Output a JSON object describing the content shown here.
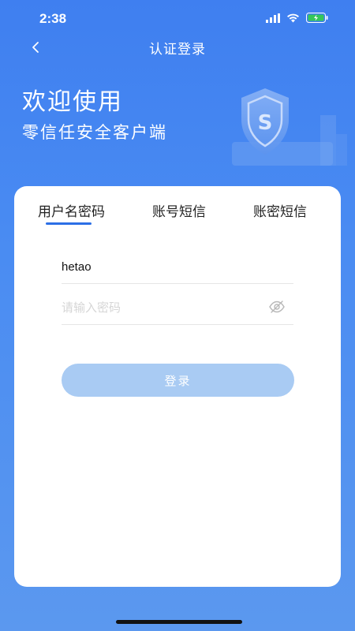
{
  "status_bar": {
    "time": "2:38"
  },
  "nav": {
    "back_icon": "chevron-left-icon",
    "title": "认证登录"
  },
  "hero": {
    "title": "欢迎使用",
    "subtitle": "零信任安全客户端",
    "shield_letter": "S"
  },
  "tabs": [
    {
      "label": "用户名密码",
      "active": true
    },
    {
      "label": "账号短信",
      "active": false
    },
    {
      "label": "账密短信",
      "active": false
    }
  ],
  "form": {
    "username_value": "hetao",
    "password_placeholder": "请输入密码",
    "password_toggle_icon": "eye-off-icon",
    "login_label": "登录"
  },
  "colors": {
    "background": "#4a8cf2",
    "active_tab_indicator": "#2c6fe6",
    "login_button": "#a9cbf3"
  }
}
